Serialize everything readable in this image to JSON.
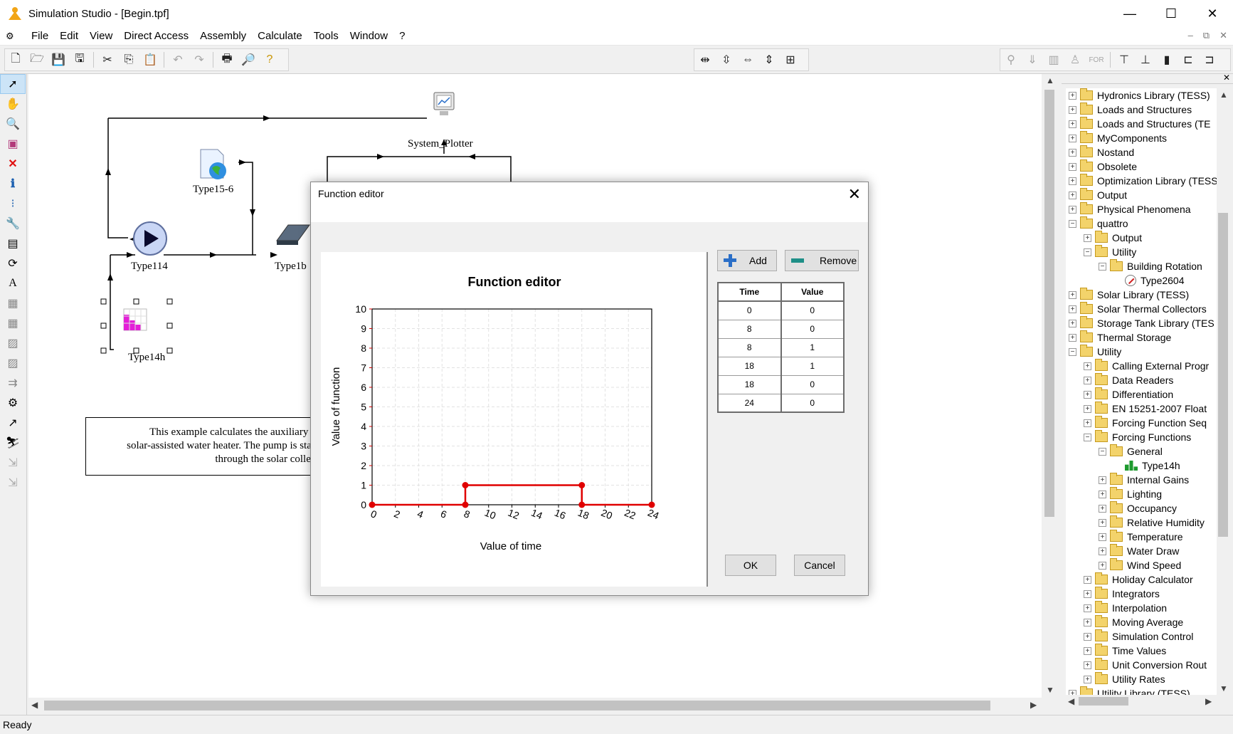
{
  "window": {
    "title": "Simulation Studio - [Begin.tpf]",
    "controls": [
      "—",
      "☐",
      "✕"
    ]
  },
  "menu": {
    "items": [
      "File",
      "Edit",
      "View",
      "Direct Access",
      "Assembly",
      "Calculate",
      "Tools",
      "Window",
      "?"
    ],
    "mdi_controls": [
      "–",
      "⧉",
      "✕"
    ]
  },
  "toolbar": {
    "file_tools": [
      "new-file-icon",
      "open-folder-icon",
      "save-icon",
      "save-all-icon",
      "cut-icon",
      "copy-icon",
      "paste-icon",
      "undo-icon",
      "redo-icon",
      "print-icon",
      "print-preview-icon",
      "help-icon"
    ],
    "align_tools": [
      "⇹",
      "⇳",
      "⇔",
      "⇕",
      "⊞"
    ],
    "right_tools": [
      "⚲",
      "⇓",
      "▥",
      "♙",
      "FOR",
      "⊤",
      "⊥",
      "▮",
      "⊏",
      "⊐"
    ]
  },
  "palette": {
    "tools": [
      "➚",
      "✋",
      "🔍",
      "▣",
      "✕",
      "ℹ",
      "⁝",
      "🔧",
      "▤",
      "⟳",
      "A",
      "▦",
      "▦",
      "▨",
      "▨",
      "⇉",
      "⚙",
      "↗",
      "⛷",
      "⇲",
      "⇲"
    ]
  },
  "canvas": {
    "nodes": {
      "plotter": "System_Plotter",
      "type15": "Type15-6",
      "type114": "Type114",
      "type1b": "Type1b",
      "type14": "Type14h"
    },
    "description_lines": [
      "This example calculates the auxiliary ene",
      "solar-assisted water heater.  The pump is sta",
      "through the solar collect"
    ]
  },
  "tree": {
    "items": [
      {
        "level": 0,
        "exp": "+",
        "label": "Hydronics Library (TESS)",
        "kind": "folder"
      },
      {
        "level": 0,
        "exp": "+",
        "label": "Loads and Structures",
        "kind": "folder"
      },
      {
        "level": 0,
        "exp": "+",
        "label": "Loads and Structures (TE",
        "kind": "folder"
      },
      {
        "level": 0,
        "exp": "+",
        "label": "MyComponents",
        "kind": "folder"
      },
      {
        "level": 0,
        "exp": "+",
        "label": "Nostand",
        "kind": "folder"
      },
      {
        "level": 0,
        "exp": "+",
        "label": "Obsolete",
        "kind": "folder"
      },
      {
        "level": 0,
        "exp": "+",
        "label": "Optimization Library (TESS",
        "kind": "folder"
      },
      {
        "level": 0,
        "exp": "+",
        "label": "Output",
        "kind": "folder"
      },
      {
        "level": 0,
        "exp": "+",
        "label": "Physical Phenomena",
        "kind": "folder"
      },
      {
        "level": 0,
        "exp": "−",
        "label": "quattro",
        "kind": "folder"
      },
      {
        "level": 1,
        "exp": "+",
        "label": "Output",
        "kind": "folder"
      },
      {
        "level": 1,
        "exp": "−",
        "label": "Utility",
        "kind": "folder"
      },
      {
        "level": 2,
        "exp": "−",
        "label": "Building Rotation",
        "kind": "folder"
      },
      {
        "level": 3,
        "exp": "",
        "label": "Type2604",
        "kind": "gauge"
      },
      {
        "level": 0,
        "exp": "+",
        "label": "Solar Library (TESS)",
        "kind": "folder"
      },
      {
        "level": 0,
        "exp": "+",
        "label": "Solar Thermal Collectors",
        "kind": "folder"
      },
      {
        "level": 0,
        "exp": "+",
        "label": "Storage Tank Library (TES",
        "kind": "folder"
      },
      {
        "level": 0,
        "exp": "+",
        "label": "Thermal Storage",
        "kind": "folder"
      },
      {
        "level": 0,
        "exp": "−",
        "label": "Utility",
        "kind": "folder"
      },
      {
        "level": 1,
        "exp": "+",
        "label": "Calling External Progr",
        "kind": "folder"
      },
      {
        "level": 1,
        "exp": "+",
        "label": "Data Readers",
        "kind": "folder"
      },
      {
        "level": 1,
        "exp": "+",
        "label": "Differentiation",
        "kind": "folder"
      },
      {
        "level": 1,
        "exp": "+",
        "label": "EN 15251-2007 Float",
        "kind": "folder"
      },
      {
        "level": 1,
        "exp": "+",
        "label": "Forcing Function Seq",
        "kind": "folder"
      },
      {
        "level": 1,
        "exp": "−",
        "label": "Forcing Functions",
        "kind": "folder"
      },
      {
        "level": 2,
        "exp": "−",
        "label": "General",
        "kind": "folder"
      },
      {
        "level": 3,
        "exp": "",
        "label": "Type14h",
        "kind": "green"
      },
      {
        "level": 2,
        "exp": "+",
        "label": "Internal Gains",
        "kind": "folder"
      },
      {
        "level": 2,
        "exp": "+",
        "label": "Lighting",
        "kind": "folder"
      },
      {
        "level": 2,
        "exp": "+",
        "label": "Occupancy",
        "kind": "folder"
      },
      {
        "level": 2,
        "exp": "+",
        "label": "Relative Humidity",
        "kind": "folder"
      },
      {
        "level": 2,
        "exp": "+",
        "label": "Temperature",
        "kind": "folder"
      },
      {
        "level": 2,
        "exp": "+",
        "label": "Water Draw",
        "kind": "folder"
      },
      {
        "level": 2,
        "exp": "+",
        "label": "Wind Speed",
        "kind": "folder"
      },
      {
        "level": 1,
        "exp": "+",
        "label": "Holiday Calculator",
        "kind": "folder"
      },
      {
        "level": 1,
        "exp": "+",
        "label": "Integrators",
        "kind": "folder"
      },
      {
        "level": 1,
        "exp": "+",
        "label": "Interpolation",
        "kind": "folder"
      },
      {
        "level": 1,
        "exp": "+",
        "label": "Moving Average",
        "kind": "folder"
      },
      {
        "level": 1,
        "exp": "+",
        "label": "Simulation Control",
        "kind": "folder"
      },
      {
        "level": 1,
        "exp": "+",
        "label": "Time Values",
        "kind": "folder"
      },
      {
        "level": 1,
        "exp": "+",
        "label": "Unit Conversion Rout",
        "kind": "folder"
      },
      {
        "level": 1,
        "exp": "+",
        "label": "Utility Rates",
        "kind": "folder"
      },
      {
        "level": 0,
        "exp": "+",
        "label": "Utility Library (TESS)",
        "kind": "folder"
      }
    ]
  },
  "status": {
    "text": "Ready"
  },
  "dialog": {
    "title": "Function editor",
    "add_label": "Add",
    "remove_label": "Remove",
    "ok_label": "OK",
    "cancel_label": "Cancel",
    "table_headers": [
      "Time",
      "Value"
    ],
    "table_rows": [
      [
        "0",
        "0"
      ],
      [
        "8",
        "0"
      ],
      [
        "8",
        "1"
      ],
      [
        "18",
        "1"
      ],
      [
        "18",
        "0"
      ],
      [
        "24",
        "0"
      ]
    ]
  },
  "chart_data": {
    "type": "line",
    "title": "Function editor",
    "xlabel": "Value of time",
    "ylabel": "Value of function",
    "xlim": [
      0,
      24
    ],
    "ylim": [
      0,
      10
    ],
    "xticks": [
      0,
      2,
      4,
      6,
      8,
      10,
      12,
      14,
      16,
      18,
      20,
      22,
      24
    ],
    "yticks": [
      0,
      1,
      2,
      3,
      4,
      5,
      6,
      7,
      8,
      9,
      10
    ],
    "grid": true,
    "line_color": "#e00000",
    "series": [
      {
        "x": [
          0,
          8,
          8,
          18,
          18,
          24
        ],
        "y": [
          0,
          0,
          1,
          1,
          0,
          0
        ]
      }
    ]
  }
}
